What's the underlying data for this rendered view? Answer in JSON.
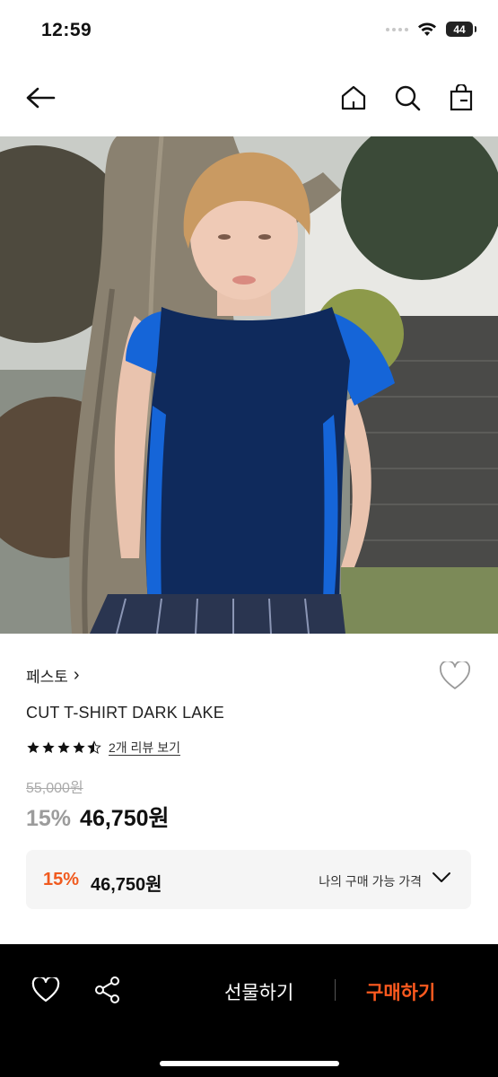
{
  "status": {
    "time": "12:59",
    "battery": "44"
  },
  "nav": {
    "back_icon": "arrow-left-icon",
    "home_icon": "home-icon",
    "search_icon": "search-icon",
    "cart_icon": "shopping-bag-icon"
  },
  "product": {
    "brand": "페스토",
    "brand_chevron": "›",
    "name": "CUT T-SHIRT DARK LAKE",
    "rating": 4.5,
    "review_link": "2개 리뷰 보기",
    "original_price": "55,000원",
    "discount_pct": "15%",
    "sale_price": "46,750원"
  },
  "my_price": {
    "discount_pct": "15%",
    "price": "46,750원",
    "label": "나의 구매 가능 가격"
  },
  "bottom": {
    "gift_label": "선물하기",
    "buy_label": "구매하기"
  },
  "colors": {
    "accent": "#ff5a1f",
    "bar_bg": "#000000",
    "shirt_navy": "#0f2a5c",
    "shirt_blue": "#1565d8"
  }
}
